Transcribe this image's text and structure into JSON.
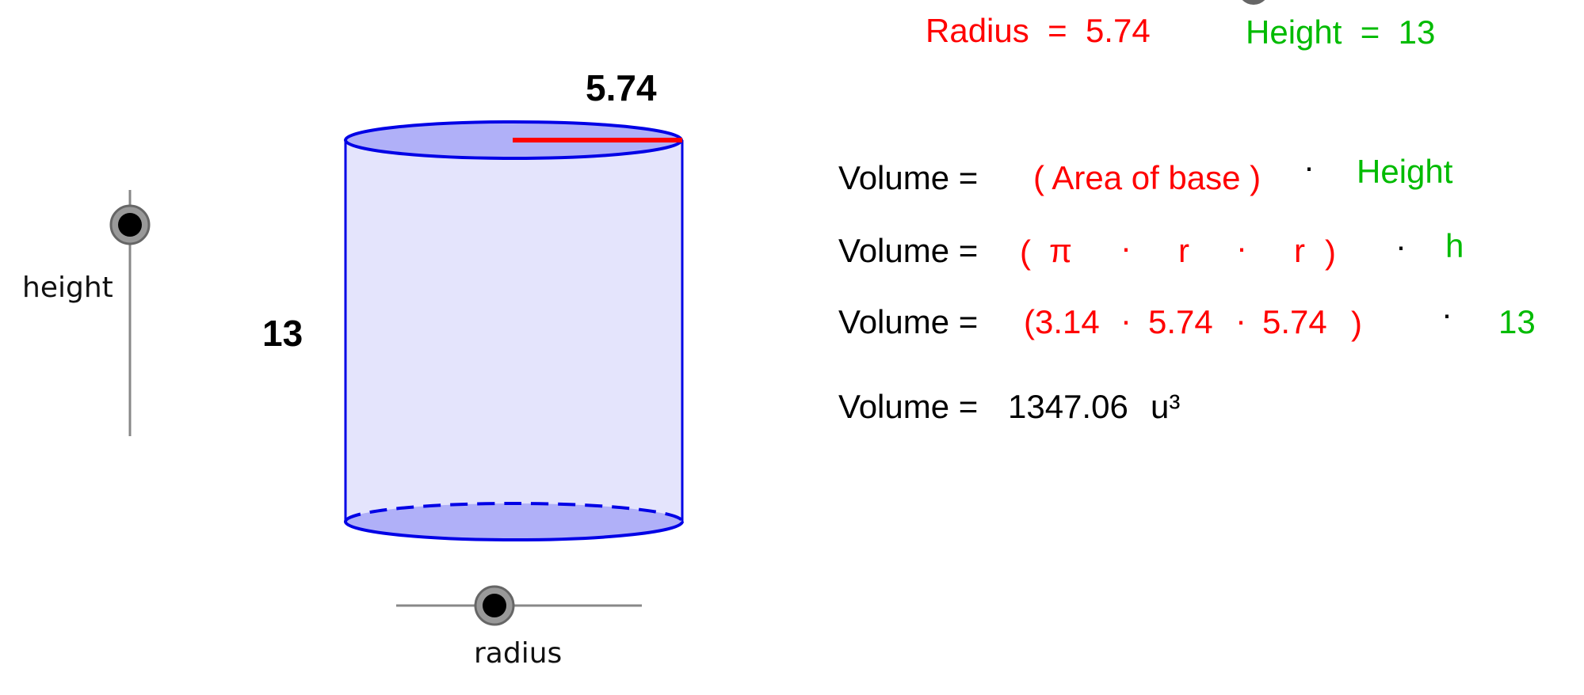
{
  "colors": {
    "radius": "#ff0000",
    "height": "#00bb00",
    "cylinder_stroke": "#0000e6",
    "cylinder_fill": "#e4e4fc",
    "base_fill": "#b0b0f8"
  },
  "header": {
    "radius_label": "Radius  =  5.74",
    "height_label": "Height  =  13"
  },
  "cylinder": {
    "radius_label": "5.74",
    "height_label": "13"
  },
  "sliders": {
    "height": {
      "label": "height",
      "value": 13
    },
    "radius": {
      "label": "radius",
      "value": 5.74
    }
  },
  "formula": {
    "line1": {
      "lhs": "Volume =",
      "base": "( Area of base )",
      "dot": "·",
      "height": "Height"
    },
    "line2": {
      "lhs": "Volume =",
      "open": "(",
      "pi": "π",
      "dot1": "·",
      "r1": "r",
      "dot2": "·",
      "r2": "r",
      "close": ")",
      "dot3": "·",
      "h": "h"
    },
    "line3": {
      "lhs": "Volume =",
      "open_pi": "(3.14",
      "dot1": "·",
      "r1": "5.74",
      "dot2": "·",
      "r2": "5.74",
      "close": ")",
      "dot3": "·",
      "h": "13"
    },
    "line4": {
      "lhs": "Volume =",
      "value": "1347.06",
      "unit": "u³"
    }
  }
}
